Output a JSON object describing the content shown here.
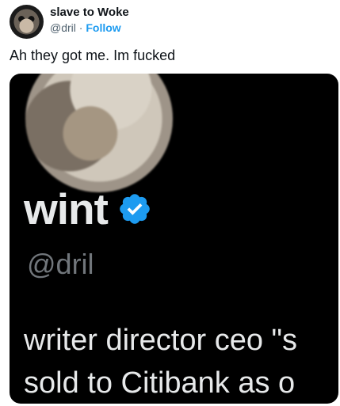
{
  "tweet": {
    "author_name": "slave to Woke",
    "author_handle": "@dril",
    "separator": "·",
    "follow_label": "Follow",
    "text": "Ah they got me. Im fucked"
  },
  "media": {
    "display_name": "wint",
    "handle": "@dril",
    "bio_line1": "writer director ceo \"s",
    "bio_line2": "sold to Citibank as o",
    "verified_badge_color": "#1d9bf0"
  }
}
